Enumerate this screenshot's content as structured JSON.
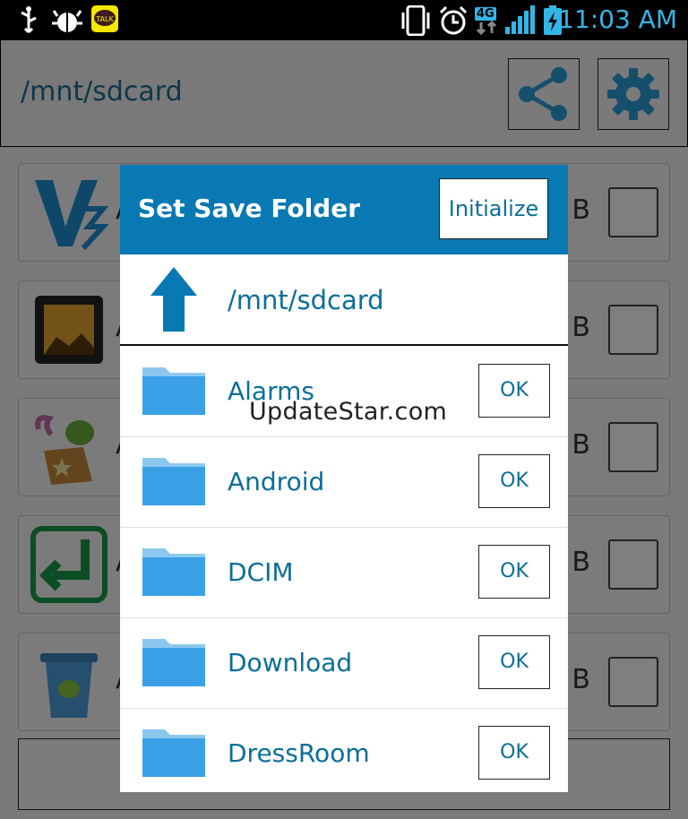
{
  "status_bar": {
    "time": "11:03 AM",
    "network": "4G",
    "icons": [
      "usb-icon",
      "debug-bug-icon",
      "kakaotalk-icon",
      "vibrate-icon",
      "alarm-icon",
      "signal-icon",
      "battery-charging-icon"
    ],
    "kakao_label": "TALK"
  },
  "app": {
    "path": "/mnt/sdcard",
    "header_buttons": [
      "share-icon",
      "gear-icon"
    ],
    "list_items": [
      {
        "icon": "v3-icon",
        "letter": "A",
        "suffix": "B"
      },
      {
        "icon": "gallery-icon",
        "letter": "A",
        "suffix": "B"
      },
      {
        "icon": "toy-box-icon",
        "letter": "A",
        "suffix": "B"
      },
      {
        "icon": "return-arrow-icon",
        "letter": "A",
        "suffix": "B"
      },
      {
        "icon": "trash-android-icon",
        "letter": "A",
        "suffix": "B"
      }
    ]
  },
  "dialog": {
    "title": "Set Save Folder",
    "initialize_label": "Initialize",
    "current_path": "/mnt/sdcard",
    "folders": [
      {
        "name": "Alarms",
        "ok": "OK"
      },
      {
        "name": "Android",
        "ok": "OK"
      },
      {
        "name": "DCIM",
        "ok": "OK"
      },
      {
        "name": "Download",
        "ok": "OK"
      },
      {
        "name": "DressRoom",
        "ok": "OK"
      }
    ]
  },
  "watermark": "UpdateStar.com",
  "colors": {
    "accent": "#0879b3",
    "text_blue": "#0b6e99",
    "clock": "#33b5e5"
  }
}
